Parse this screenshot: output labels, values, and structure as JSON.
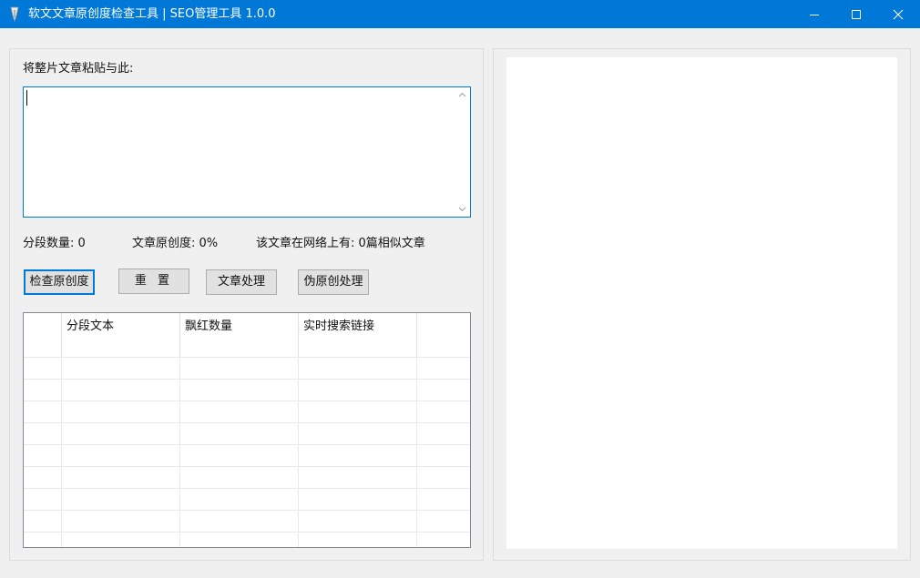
{
  "window": {
    "title": "软文文章原创度检查工具 | SEO管理工具  1.0.0",
    "icon": "pen-nib-icon",
    "accent": "#0078d7"
  },
  "input": {
    "label": "将整片文章粘贴与此:",
    "value": ""
  },
  "stats": {
    "segments": "分段数量:  0",
    "originality": "文章原创度:  0%",
    "similar": "该文章在网络上有:  0篇相似文章"
  },
  "buttons": {
    "check": "检查原创度",
    "reset": "重 置",
    "process": "文章处理",
    "pseudo": "伪原创处理"
  },
  "table": {
    "columns": [
      "",
      "分段文本",
      "飘红数量",
      "实时搜索链接",
      ""
    ],
    "rows": [
      [
        "",
        "",
        "",
        "",
        ""
      ],
      [
        "",
        "",
        "",
        "",
        ""
      ],
      [
        "",
        "",
        "",
        "",
        ""
      ],
      [
        "",
        "",
        "",
        "",
        ""
      ],
      [
        "",
        "",
        "",
        "",
        ""
      ],
      [
        "",
        "",
        "",
        "",
        ""
      ],
      [
        "",
        "",
        "",
        "",
        ""
      ],
      [
        "",
        "",
        "",
        "",
        ""
      ],
      [
        "",
        "",
        "",
        "",
        ""
      ]
    ]
  }
}
